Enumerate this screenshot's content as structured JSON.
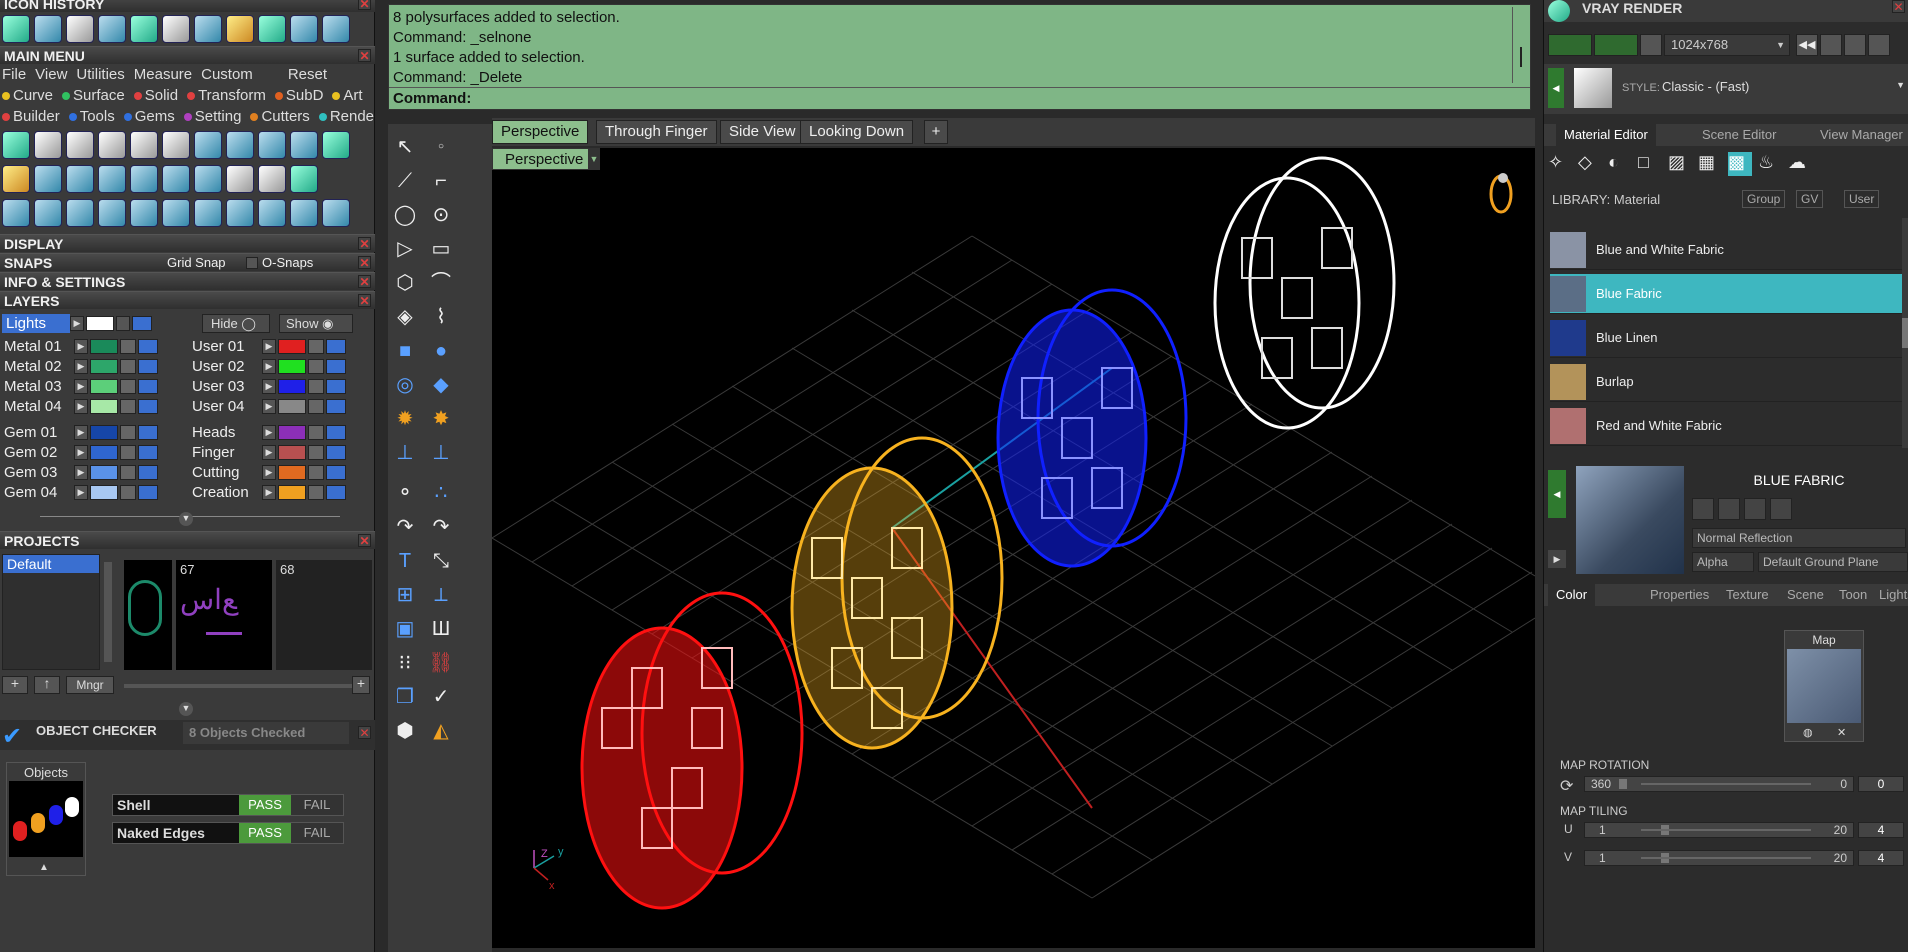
{
  "left": {
    "icon_history_title": "ICON HISTORY",
    "main_menu_title": "MAIN MENU",
    "main_menu_row1": [
      "File",
      "View",
      "Utilities",
      "Measure",
      "Custom",
      "Reset"
    ],
    "main_menu_row2": [
      "Curve",
      "Surface",
      "Solid",
      "Transform",
      "SubD",
      "Art"
    ],
    "main_menu_row3": [
      "Builder",
      "Tools",
      "Gems",
      "Setting",
      "Cutters",
      "Render"
    ],
    "display_title": "DISPLAY",
    "snaps_title": "SNAPS",
    "grid_snap": "Grid Snap",
    "osnaps": "O-Snaps",
    "info_title": "INFO & SETTINGS",
    "layers_title": "LAYERS",
    "lights": "Lights",
    "hide": "Hide",
    "show": "Show",
    "layers_left": [
      {
        "name": "Metal 01",
        "color": "#1a8a5a"
      },
      {
        "name": "Metal 02",
        "color": "#2da66a"
      },
      {
        "name": "Metal 03",
        "color": "#5ccf7a"
      },
      {
        "name": "Metal 04",
        "color": "#a7e8a7"
      },
      {
        "name": "Gem 01",
        "color": "#1646a8"
      },
      {
        "name": "Gem 02",
        "color": "#2f66d0"
      },
      {
        "name": "Gem 03",
        "color": "#5a92e8"
      },
      {
        "name": "Gem 04",
        "color": "#a8c8f2"
      }
    ],
    "layers_right": [
      {
        "name": "User 01",
        "color": "#e02020"
      },
      {
        "name": "User 02",
        "color": "#20e020"
      },
      {
        "name": "User 03",
        "color": "#1f20e8"
      },
      {
        "name": "User 04",
        "color": "#888888"
      },
      {
        "name": "Heads",
        "color": "#8c2fb8"
      },
      {
        "name": "Finger",
        "color": "#b85050"
      },
      {
        "name": "Cutting",
        "color": "#e06a20"
      },
      {
        "name": "Creation",
        "color": "#f0a020"
      }
    ],
    "projects_title": "PROJECTS",
    "project_default": "Default",
    "project_num_1": "67",
    "project_num_2": "68",
    "mngr": "Mngr",
    "checker_title": "OBJECT CHECKER",
    "checker_count": "8  Objects Checked",
    "objects_label": "Objects",
    "checks": [
      {
        "name": "Shell",
        "pass": "PASS",
        "fail": "FAIL"
      },
      {
        "name": "Naked Edges",
        "pass": "PASS",
        "fail": "FAIL"
      }
    ]
  },
  "command": {
    "lines": [
      "8 polysurfaces added to selection.",
      "Command: _selnone",
      "1 surface added to selection.",
      "Command: _Delete"
    ],
    "prompt": "Command:"
  },
  "viewport": {
    "tabs": [
      "Perspective",
      "Through Finger",
      "Side View",
      "Looking Down"
    ],
    "add_tab": "+",
    "view_label": "Perspective",
    "axis_z": "Z",
    "axis_y": "y",
    "axis_x": "x",
    "rings": [
      {
        "name": "red-ring",
        "color": "#ff1010"
      },
      {
        "name": "gold-ring",
        "color": "#f7b21f"
      },
      {
        "name": "blue-ring",
        "color": "#1020ff"
      },
      {
        "name": "white-ring",
        "color": "#ffffff"
      }
    ]
  },
  "right": {
    "title": "VRAY RENDER",
    "resolution": "1024x768",
    "style_label": "STYLE:",
    "style_value": "Classic - (Fast)",
    "tabs": [
      "Material Editor",
      "Scene Editor",
      "View Manager"
    ],
    "library_label": "LIBRARY: Material",
    "group": "Group",
    "gv": "GV",
    "user": "User",
    "materials": [
      {
        "name": "Blue and White Fabric",
        "color": "#8a93a5"
      },
      {
        "name": "Blue Fabric",
        "color": "#5b6e86"
      },
      {
        "name": "Blue Linen",
        "color": "#1f3a8c"
      },
      {
        "name": "Burlap",
        "color": "#b3935a"
      },
      {
        "name": "Red and White Fabric",
        "color": "#b07070"
      }
    ],
    "selected_material": "BLUE FABRIC",
    "reflection": "Normal Reflection",
    "alpha": "Alpha",
    "ground": "Default Ground Plane",
    "sub_tabs": [
      "Color",
      "Properties",
      "Texture",
      "Scene",
      "Toon",
      "Lights"
    ],
    "map_label": "Map",
    "map_rotation": "MAP ROTATION",
    "rot_min": "360",
    "rot_max": "0",
    "rot_value": "0",
    "map_tiling": "MAP TILING",
    "u_label": "U",
    "v_label": "V",
    "tile_min": "1",
    "tile_max": "20",
    "u_value": "4",
    "v_value": "4"
  }
}
